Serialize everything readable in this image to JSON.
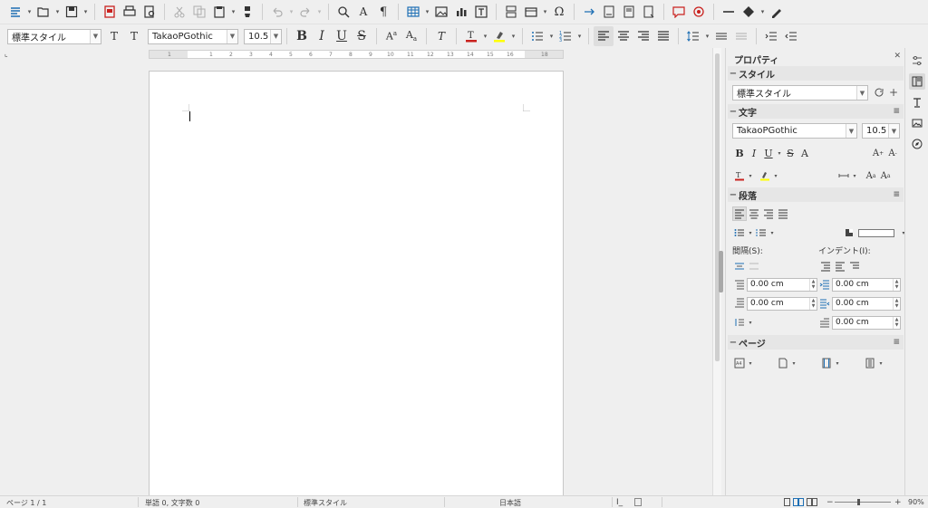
{
  "toolbar2": {
    "paragraph_style": "標準スタイル",
    "font_name": "TakaoPGothic",
    "font_size": "10.5"
  },
  "ruler": {
    "labels": [
      "1",
      "2",
      "3",
      "4",
      "5",
      "6",
      "7",
      "8",
      "9",
      "10",
      "11",
      "12",
      "13",
      "14",
      "15",
      "16",
      "18"
    ]
  },
  "sidebar": {
    "title": "プロパティ",
    "style_section": {
      "title": "スタイル",
      "value": "標準スタイル"
    },
    "character_section": {
      "title": "文字",
      "font": "TakaoPGothic",
      "size": "10.5"
    },
    "paragraph_section": {
      "title": "段落",
      "spacing_label": "間隔(S):",
      "indent_label": "インデント(I):",
      "above": "0.00 cm",
      "below": "0.00 cm",
      "before_text": "0.00 cm",
      "after_text": "0.00 cm",
      "first_line": "0.00 cm"
    },
    "page_section": {
      "title": "ページ"
    }
  },
  "statusbar": {
    "page": "ページ 1 / 1",
    "words": "単語 0, 文字数 0",
    "style": "標準スタイル",
    "language": "日本語",
    "zoom_minus": "−",
    "zoom_plus": "+",
    "zoom": "90%"
  },
  "colors": {
    "font_color": "#c9211e",
    "highlight": "#ffff00",
    "accent": "#1e6fb4"
  }
}
